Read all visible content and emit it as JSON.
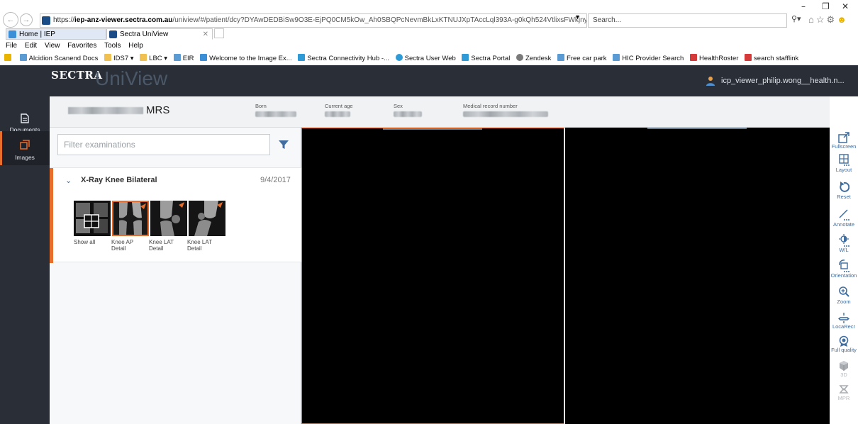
{
  "browser": {
    "window_controls": {
      "minimize": "–",
      "restore": "❐",
      "close": "✕"
    },
    "address": {
      "scheme": "https://",
      "host": "iep-anz-viewer.sectra.com.au",
      "path": "/uniview/#/patient/dcy?DYAwDEDBiSw9O3E-EjPQ0CM5kOw_Ah0SBQPcNevmBkLxKTNUJXpTAccLql393A-g0kQh524VtlixsFWkjny_kA_cuMJHrklS-tl"
    },
    "search_placeholder": "Search...",
    "tabs": [
      {
        "label": "Home | IEP"
      },
      {
        "label": "Sectra UniView"
      }
    ],
    "menu": [
      "File",
      "Edit",
      "View",
      "Favorites",
      "Tools",
      "Help"
    ],
    "favorites": [
      {
        "label": "Alcidion Scanend Docs",
        "color": "#5a9bd4"
      },
      {
        "label": "IDS7 ▾",
        "color": "#f0c050"
      },
      {
        "label": "LBC ▾",
        "color": "#f0c050"
      },
      {
        "label": "EIR",
        "color": "#5a9bd4"
      },
      {
        "label": "Welcome to the Image Ex...",
        "color": "#3a8fd6"
      },
      {
        "label": "Sectra Connectivity Hub -...",
        "color": "#2f9bd6"
      },
      {
        "label": "Sectra User Web",
        "color": "#2f9bd6"
      },
      {
        "label": "Sectra Portal",
        "color": "#2f9bd6"
      },
      {
        "label": "Zendesk",
        "color": "#7a7a7a"
      },
      {
        "label": "Free car park",
        "color": "#5a9bd4"
      },
      {
        "label": "HIC Provider Search",
        "color": "#5a9bd4"
      },
      {
        "label": "HealthRoster",
        "color": "#d43a3a"
      },
      {
        "label": "search stafflink",
        "color": "#d43a3a"
      }
    ]
  },
  "app": {
    "brand": "SECTRA",
    "product": "UniView",
    "user": "icp_viewer_philip.wong__health.n...",
    "sidebar": [
      {
        "label": "Documents",
        "icon": "document-icon"
      },
      {
        "label": "Images",
        "icon": "images-icon"
      }
    ]
  },
  "patient": {
    "title": "MRS",
    "fields": [
      {
        "label": "Born"
      },
      {
        "label": "Current age"
      },
      {
        "label": "Sex"
      },
      {
        "label": "Medical record number"
      }
    ]
  },
  "exams": {
    "filter_placeholder": "Filter examinations",
    "items": [
      {
        "title": "X-Ray Knee Bilateral",
        "date": "9/4/2017",
        "series": [
          {
            "caption": "Show all"
          },
          {
            "caption": "Knee AP Detail"
          },
          {
            "caption": "Knee LAT Detail"
          },
          {
            "caption": "Knee LAT Detail"
          }
        ]
      }
    ]
  },
  "toolbar": [
    {
      "label": "Fullscreen",
      "icon": "fullscreen-icon",
      "enabled": true
    },
    {
      "label": "Layout",
      "icon": "layout-icon",
      "enabled": true
    },
    {
      "label": "Reset",
      "icon": "reset-icon",
      "enabled": true
    },
    {
      "label": "Annotate",
      "icon": "annotate-icon",
      "enabled": true
    },
    {
      "label": "W/L",
      "icon": "window-level-icon",
      "enabled": true
    },
    {
      "label": "Orientation",
      "icon": "orientation-icon",
      "enabled": true
    },
    {
      "label": "Zoom",
      "icon": "zoom-icon",
      "enabled": true
    },
    {
      "label": "LocaRecr",
      "icon": "localizer-icon",
      "enabled": true
    },
    {
      "label": "Full quality",
      "icon": "full-quality-icon",
      "enabled": true
    },
    {
      "label": "3D",
      "icon": "cube-3d-icon",
      "enabled": false
    },
    {
      "label": "MPR",
      "icon": "mpr-icon",
      "enabled": false
    }
  ],
  "colors": {
    "accent": "#e76f2b",
    "header_bg": "#2a2e37",
    "tool_blue": "#3f6da0"
  }
}
